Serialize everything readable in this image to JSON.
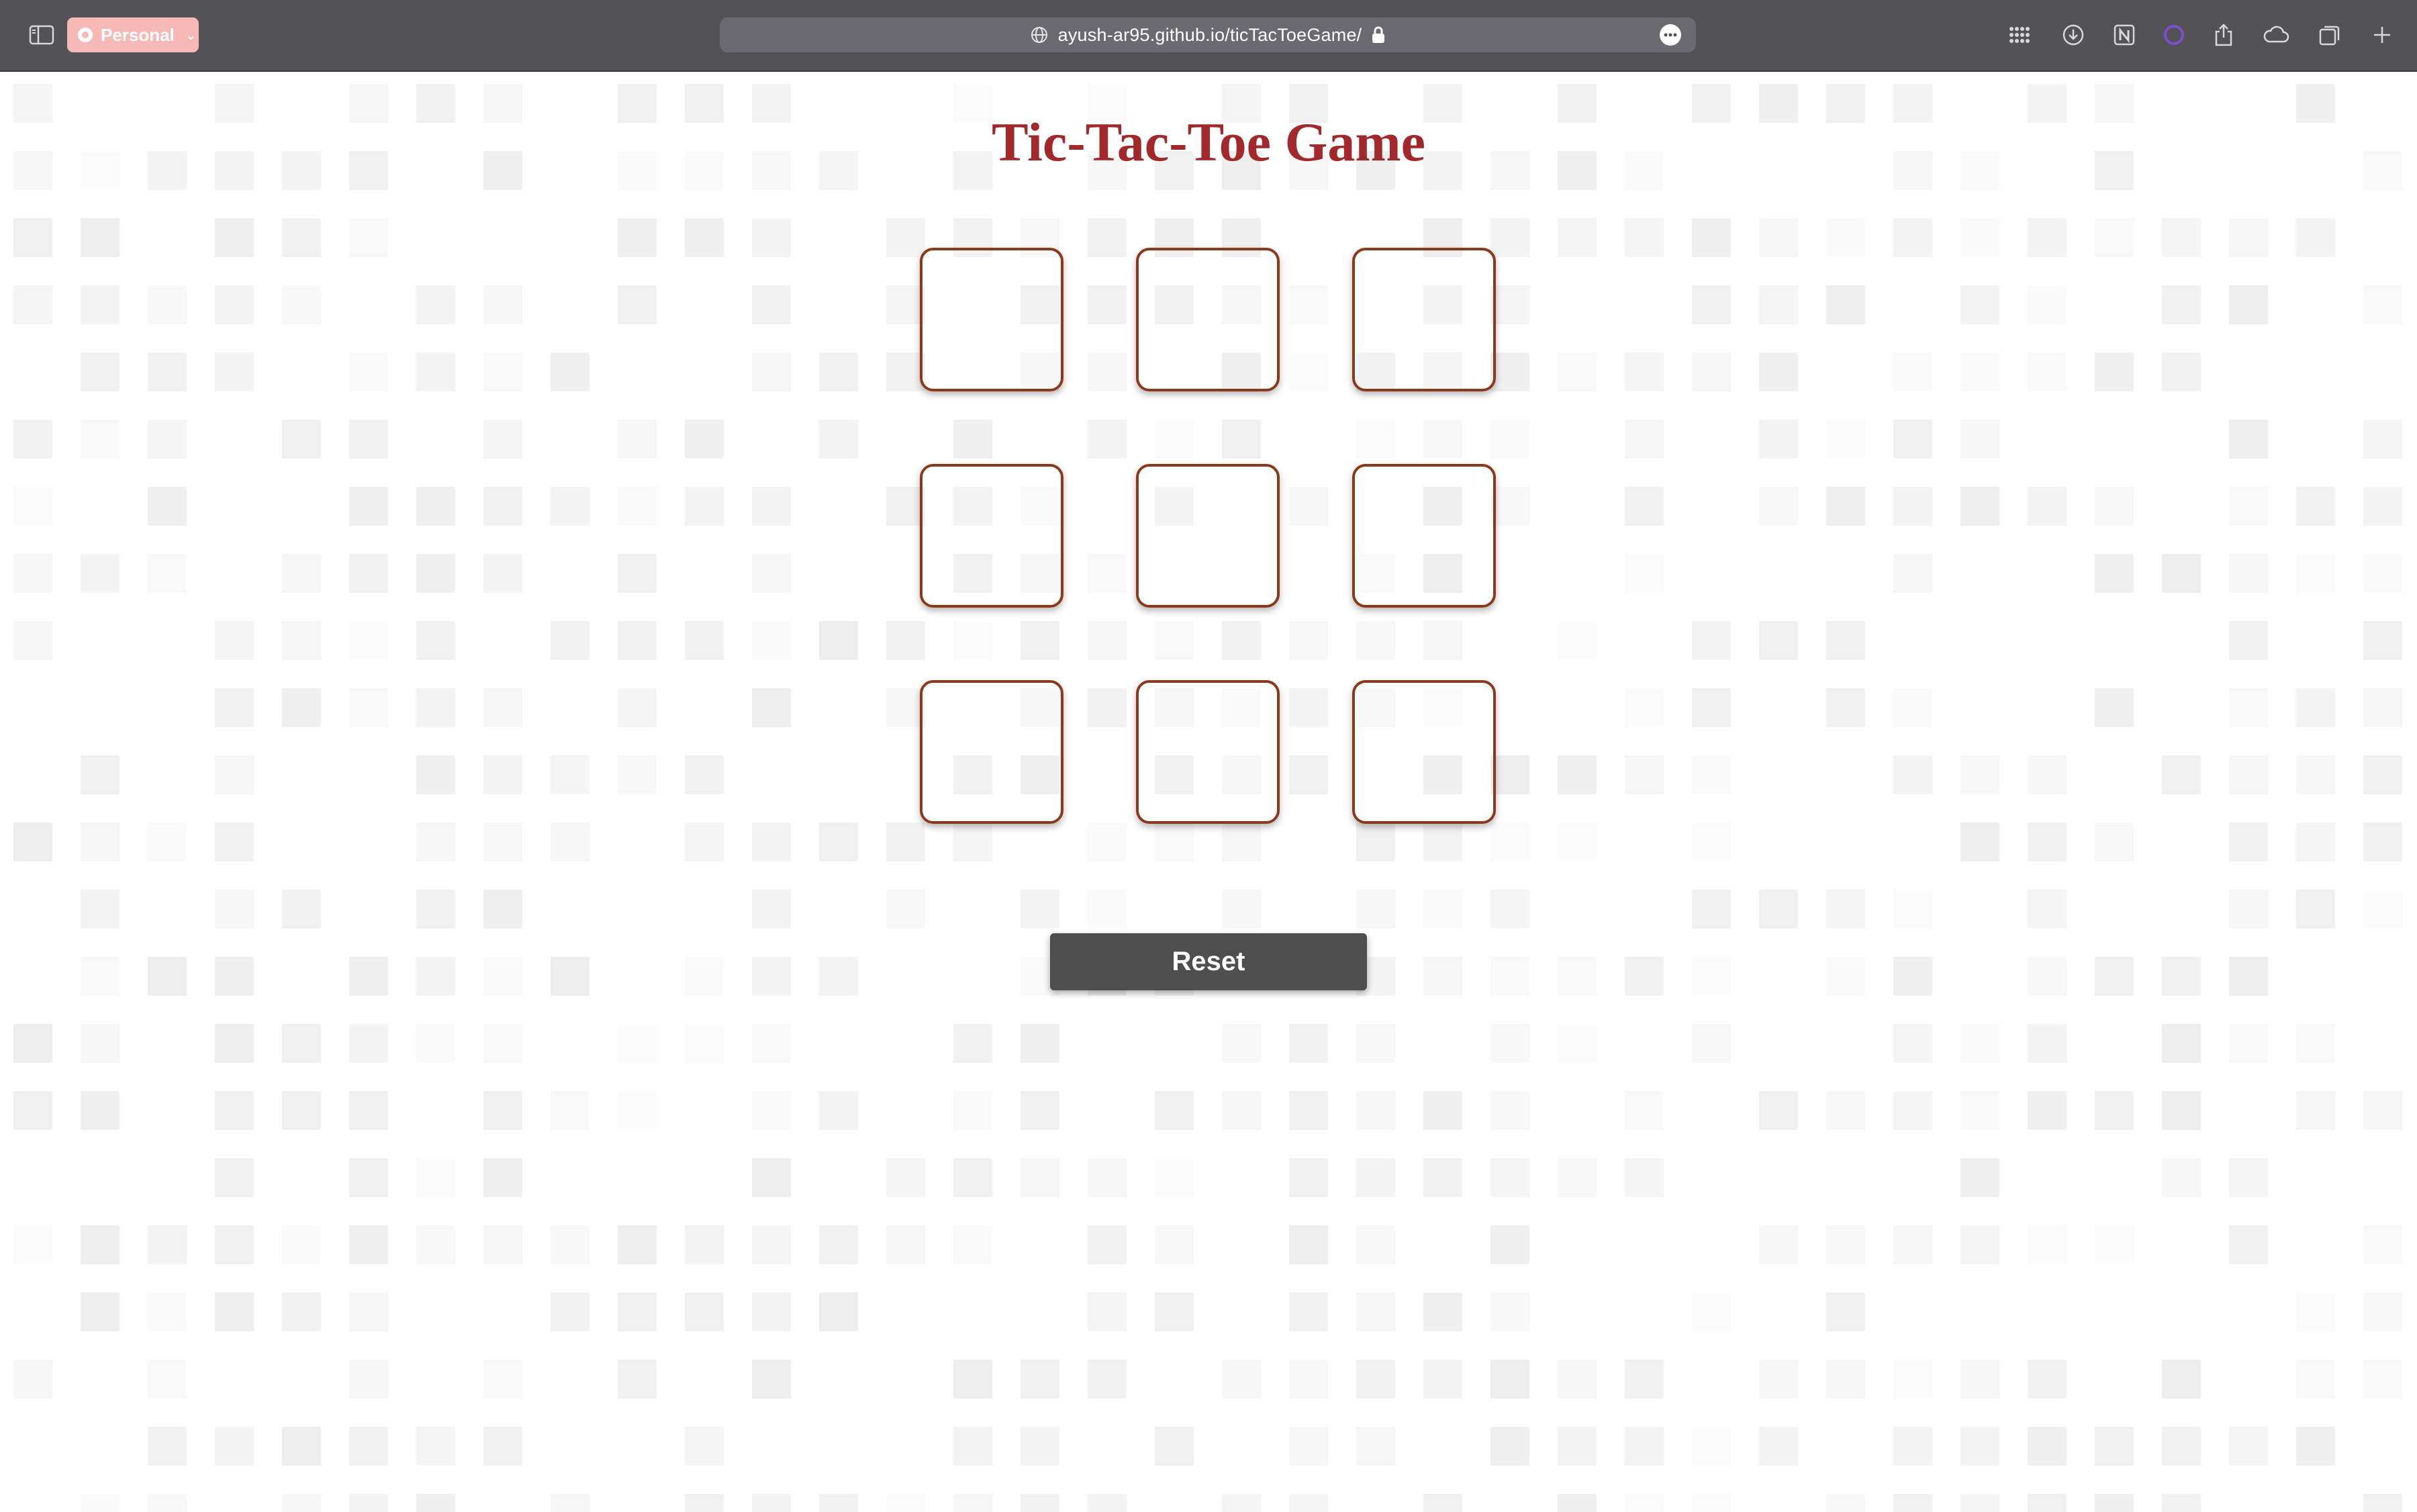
{
  "browser": {
    "profile_label": "Personal",
    "url": "ayush-ar95.github.io/ticTacToeGame/",
    "toolbar_icons": [
      "sidebar-icon",
      "grid-icon",
      "download-icon",
      "notion-icon",
      "circle-extension-icon",
      "share-icon",
      "cloud-icon",
      "tabs-overview-icon",
      "new-tab-icon"
    ],
    "colors": {
      "toolbar": "#535257",
      "profile_badge": "#f7b9b6",
      "url_field": "#6b6a70"
    }
  },
  "page": {
    "title": "Tic-Tac-Toe Game",
    "cells": [
      "",
      "",
      "",
      "",
      "",
      "",
      "",
      "",
      ""
    ],
    "reset_label": "Reset",
    "colors": {
      "title": "#a2292b",
      "cell_border": "#8a3a1a",
      "reset_bg": "#4e4e4e"
    }
  }
}
